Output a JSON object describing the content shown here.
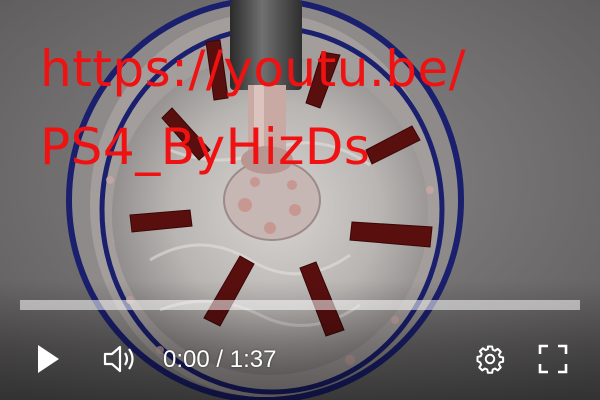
{
  "overlay": {
    "url_line1": "https://youtu.be/",
    "url_line2": "PS4_ByHizDs"
  },
  "player": {
    "current_time": "0:00",
    "separator": " / ",
    "duration": "1:37",
    "progress_fraction": 0.0,
    "accent_color": "#ff0000",
    "controls": {
      "play_icon": "play-icon",
      "volume_icon": "volume-icon",
      "settings_icon": "gear-icon",
      "fullscreen_icon": "fullscreen-icon"
    }
  }
}
